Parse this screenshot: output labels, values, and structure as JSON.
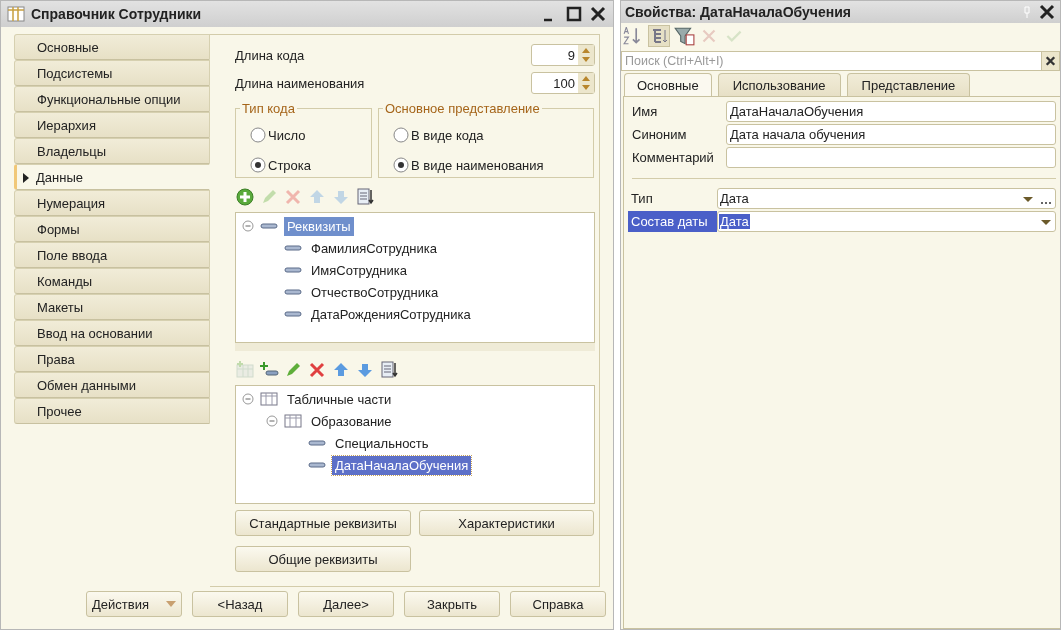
{
  "window": {
    "title": "Справочник Сотрудники"
  },
  "sections": [
    {
      "label": "Основные",
      "selected": false
    },
    {
      "label": "Подсистемы",
      "selected": false
    },
    {
      "label": "Функциональные опции",
      "selected": false
    },
    {
      "label": "Иерархия",
      "selected": false
    },
    {
      "label": "Владельцы",
      "selected": false
    },
    {
      "label": "Данные",
      "selected": true
    },
    {
      "label": "Нумерация",
      "selected": false
    },
    {
      "label": "Формы",
      "selected": false
    },
    {
      "label": "Поле ввода",
      "selected": false
    },
    {
      "label": "Команды",
      "selected": false
    },
    {
      "label": "Макеты",
      "selected": false
    },
    {
      "label": "Ввод на основании",
      "selected": false
    },
    {
      "label": "Права",
      "selected": false
    },
    {
      "label": "Обмен данными",
      "selected": false
    },
    {
      "label": "Прочее",
      "selected": false
    }
  ],
  "number_fields": [
    {
      "label": "Длина кода",
      "value": "9"
    },
    {
      "label": "Длина наименования",
      "value": "100"
    }
  ],
  "radio_groups": [
    {
      "title": "Тип кода",
      "options": [
        {
          "label": "Число",
          "selected": false
        },
        {
          "label": "Строка",
          "selected": true
        }
      ]
    },
    {
      "title": "Основное представление",
      "options": [
        {
          "label": "В виде кода",
          "selected": false
        },
        {
          "label": "В виде наименования",
          "selected": true
        }
      ]
    }
  ],
  "attributes_toolbar": [
    {
      "kind": "add",
      "disabled": false
    },
    {
      "kind": "edit",
      "disabled": true
    },
    {
      "kind": "delete",
      "disabled": true
    },
    {
      "kind": "up",
      "disabled": true
    },
    {
      "kind": "down",
      "disabled": true
    },
    {
      "kind": "sort",
      "disabled": false
    }
  ],
  "attributes_tree": [
    {
      "label": "Реквизиты",
      "kind": "attribute",
      "selected": true,
      "expanded": true,
      "children": [
        {
          "label": "ФамилияСотрудника",
          "kind": "attribute",
          "selected": false
        },
        {
          "label": "ИмяСотрудника",
          "kind": "attribute",
          "selected": false
        },
        {
          "label": "ОтчествоСотрудника",
          "kind": "attribute",
          "selected": false
        },
        {
          "label": "ДатаРожденияСотрудника",
          "kind": "attribute",
          "selected": false
        }
      ]
    }
  ],
  "tables_toolbar": [
    {
      "kind": "add_table",
      "disabled": true
    },
    {
      "kind": "add_attribute",
      "disabled": false
    },
    {
      "kind": "edit",
      "disabled": false
    },
    {
      "kind": "delete",
      "disabled": false
    },
    {
      "kind": "up",
      "disabled": false
    },
    {
      "kind": "down",
      "disabled": false
    },
    {
      "kind": "sort",
      "disabled": false
    }
  ],
  "tables_tree": [
    {
      "label": "Табличные части",
      "kind": "table",
      "selected": false,
      "expanded": true,
      "children": [
        {
          "label": "Образование",
          "kind": "table",
          "selected": false,
          "expanded": true,
          "children": [
            {
              "label": "Специальность",
              "kind": "attribute",
              "selected": false
            },
            {
              "label": "ДатаНачалаОбучения",
              "kind": "attribute",
              "selected": true
            }
          ]
        }
      ]
    }
  ],
  "panel_buttons": [
    "Стандартные реквизиты",
    "Характеристики",
    "Общие реквизиты"
  ],
  "footer": {
    "actions": "Действия",
    "buttons": [
      "<Назад",
      "Далее>",
      "Закрыть",
      "Справка"
    ]
  },
  "properties": {
    "title": "Свойства: ДатаНачалаОбучения",
    "toolbar": [
      {
        "kind": "sort_az",
        "selected": false,
        "disabled": false
      },
      {
        "kind": "categories",
        "selected": true,
        "disabled": false
      },
      {
        "kind": "filter",
        "selected": false,
        "disabled": false
      },
      {
        "kind": "cancel",
        "selected": false,
        "disabled": true
      },
      {
        "kind": "apply",
        "selected": false,
        "disabled": true
      }
    ],
    "search": {
      "placeholder": "Поиск (Ctrl+Alt+I)"
    },
    "tabs": [
      {
        "label": "Основные",
        "selected": true
      },
      {
        "label": "Использование",
        "selected": false
      },
      {
        "label": "Представление",
        "selected": false
      }
    ],
    "text_fields": [
      {
        "label": "Имя",
        "value": "ДатаНачалаОбучения"
      },
      {
        "label": "Синоним",
        "value": "Дата начала обучения"
      },
      {
        "label": "Комментарий"
      }
    ],
    "type_field": {
      "label": "Тип",
      "value": "Дата"
    },
    "date_composition": {
      "label": "Состав даты",
      "value": "Дата",
      "selected": true
    }
  }
}
